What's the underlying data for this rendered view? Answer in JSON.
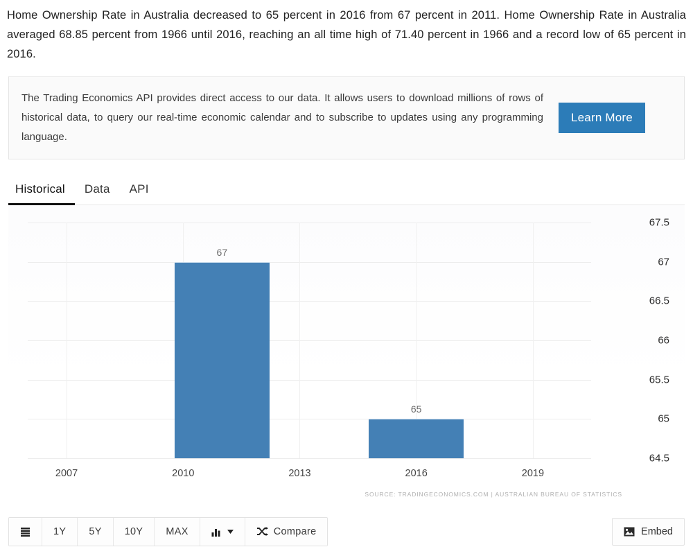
{
  "intro": {
    "text": "Home Ownership Rate in Australia decreased to 65 percent in 2016 from 67 percent in 2011. Home Ownership Rate in Australia averaged 68.85 percent from 1966 until 2016, reaching an all time high of 71.40 percent in 1966 and a record low of 65 percent in 2016."
  },
  "api_box": {
    "text": "The Trading Economics API provides direct access to our data. It allows users to download millions of rows of historical data, to query our real-time economic calendar and to subscribe to updates using any programming language.",
    "button_label": "Learn More",
    "button_color": "#2c7cb8"
  },
  "tabs": [
    {
      "label": "Historical",
      "active": true
    },
    {
      "label": "Data",
      "active": false
    },
    {
      "label": "API",
      "active": false
    }
  ],
  "chart_data": {
    "type": "bar",
    "title": "",
    "xlabel": "",
    "ylabel": "",
    "categories": [
      2011,
      2016
    ],
    "values": [
      67,
      65
    ],
    "data_labels": [
      "67",
      "65"
    ],
    "bar_color": "#4480b5",
    "ylim": [
      64.5,
      67.5
    ],
    "yticks": [
      67.5,
      67,
      66.5,
      66,
      65.5,
      65,
      64.5
    ],
    "ytick_labels": [
      "67.5",
      "67",
      "66.5",
      "66",
      "65.5",
      "65",
      "64.5"
    ],
    "xlim": [
      2006,
      2020.5
    ],
    "xticks": [
      2007,
      2010,
      2013,
      2016,
      2019
    ],
    "xtick_labels": [
      "2007",
      "2010",
      "2013",
      "2016",
      "2019"
    ],
    "grid": true,
    "y_axis_position": "right",
    "legend": "none",
    "source": "SOURCE: TRADINGECONOMICS.COM | AUSTRALIAN BUREAU OF STATISTICS"
  },
  "toolbar": {
    "menu_label": "",
    "ranges": [
      "1Y",
      "5Y",
      "10Y",
      "MAX"
    ],
    "chart_type_label": "",
    "compare_label": "Compare",
    "embed_label": "Embed"
  }
}
